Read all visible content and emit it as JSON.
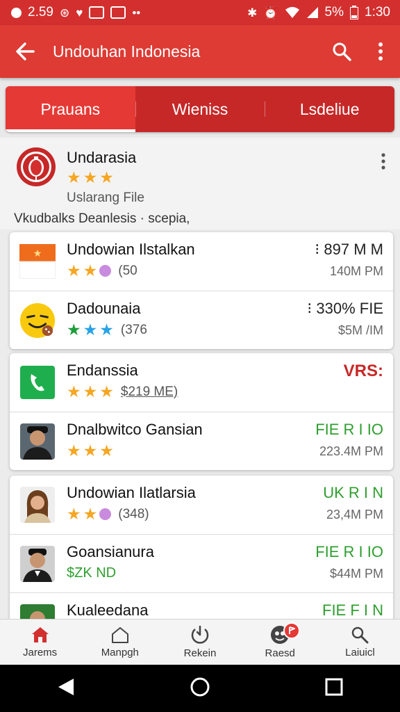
{
  "status_bar": {
    "time_left": "2.59",
    "battery": "5%",
    "time_right": "1:30"
  },
  "app_bar": {
    "title": "Undouhan Indonesia"
  },
  "tabs": [
    {
      "label": "Prauans",
      "active": true
    },
    {
      "label": "Wieniss",
      "active": false
    },
    {
      "label": "Lsdeliue",
      "active": false
    }
  ],
  "featured": {
    "name": "Undarasia",
    "rating_stars": 3,
    "subtitle": "Uslarang File",
    "description": "Vkudbalks Deanlesis · scepia,"
  },
  "cards": [
    {
      "rows": [
        {
          "icon": "flag-icon",
          "title": "Undowian Ilstalkan",
          "stars": 2,
          "star_color": "yellow",
          "extra_dot": true,
          "count": "(50",
          "right_top": "⁝ 897 M M",
          "right_bottom": "140M PM"
        },
        {
          "icon": "sun-face-icon",
          "title": "Dadounaia",
          "stars": 3,
          "star_color": "green-blue",
          "extra_dot": false,
          "count": "(376",
          "right_top": "⁝ 330% FIE",
          "right_bottom": "$5M /IM"
        }
      ]
    },
    {
      "rows": [
        {
          "icon": "phone-app-icon",
          "title": "Endanssia",
          "stars": 3,
          "star_color": "yellow",
          "extra_dot": false,
          "count": "$219 ME)",
          "right_top": "VRS:",
          "right_bottom": ""
        },
        {
          "icon": "person-avatar-icon",
          "title": "Dnalbwitco Gansian",
          "stars": 3,
          "star_color": "yellow",
          "extra_dot": false,
          "count": "",
          "right_top": "FIE R I IO",
          "right_bottom": "223.4M PM"
        }
      ]
    },
    {
      "rows": [
        {
          "icon": "woman-avatar-icon",
          "title": "Undowian Ilatlarsia",
          "stars": 2,
          "star_color": "yellow",
          "extra_dot": true,
          "count": "(348)",
          "right_top": "UK R I N",
          "right_bottom": "23,4M PM"
        },
        {
          "icon": "man-avatar-icon",
          "title": "Goansianura",
          "stars": 0,
          "star_color": "yellow",
          "extra_dot": false,
          "count": "$ZK ND",
          "right_top": "FIE R I IO",
          "right_bottom": "$44M PM"
        },
        {
          "icon": "person-avatar-icon",
          "title": "Kualeedana",
          "stars": 0,
          "star_color": "yellow",
          "extra_dot": false,
          "count": "",
          "right_top": "FIE F I N",
          "right_bottom": ""
        }
      ]
    }
  ],
  "bottom_nav": [
    {
      "label": "Jarems",
      "icon": "home-icon",
      "active": true
    },
    {
      "label": "Manpgh",
      "icon": "house-outline-icon",
      "active": false
    },
    {
      "label": "Rekein",
      "icon": "refresh-icon",
      "active": false
    },
    {
      "label": "Raesd",
      "icon": "account-icon",
      "active": false,
      "badge": ""
    },
    {
      "label": "Laiuicl",
      "icon": "search-icon",
      "active": false
    }
  ],
  "colors": {
    "primary": "#dd3b34",
    "tab_bg": "#c62828",
    "star": "#f5a623",
    "green_text": "#2e9e2e"
  }
}
